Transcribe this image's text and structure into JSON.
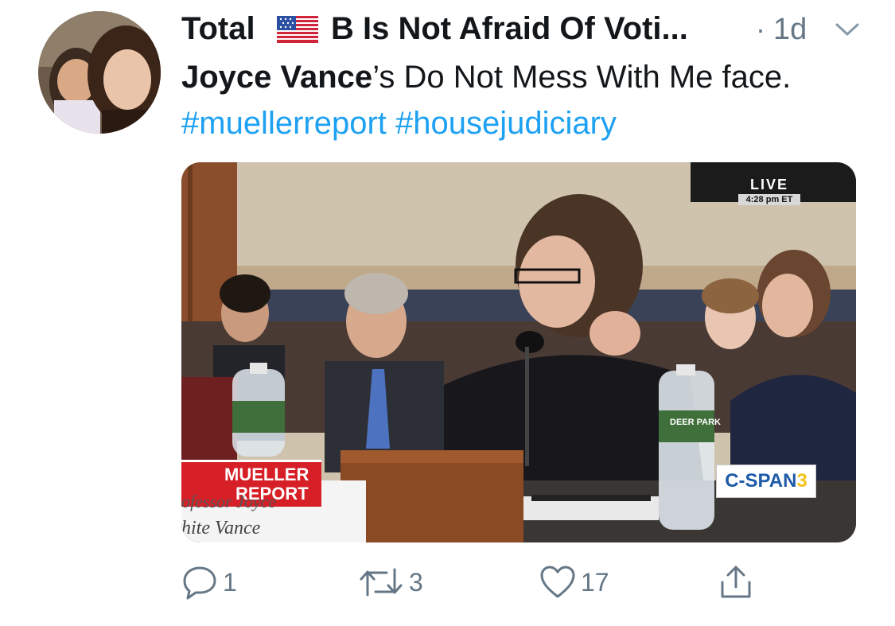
{
  "tweet": {
    "author_name_part1": "Total",
    "author_name_part2": "B Is Not Afraid Of Voti...",
    "time_separator": "·",
    "time": "1d",
    "text_bold": "Joyce Vance",
    "text_main": "’s Do Not Mess With Me face.",
    "hashtags": [
      "#muellerreport",
      "#housejudiciary"
    ],
    "icons": {
      "avatar": "profile-photo",
      "flag": "us-flag-emoji",
      "more": "chevron-down-icon"
    }
  },
  "media": {
    "live_label": "LIVE",
    "live_time": "4:28 pm ET",
    "banner_line1": "MUELLER",
    "banner_line2": "REPORT",
    "nameplate_line1": "ofessor Joyce",
    "nameplate_line2": "hite Vance",
    "network_logo_main": "C-SPAN",
    "network_logo_num": "3",
    "bottle_brand": "DEER PARK"
  },
  "actions": {
    "reply_count": "1",
    "retweet_count": "3",
    "like_count": "17"
  },
  "colors": {
    "hashtag": "#1da1f2",
    "secondary_text": "#657786",
    "banner_red": "#d61f26",
    "cspan_blue": "#1e5aa8",
    "cspan_yellow": "#f4c21a"
  }
}
